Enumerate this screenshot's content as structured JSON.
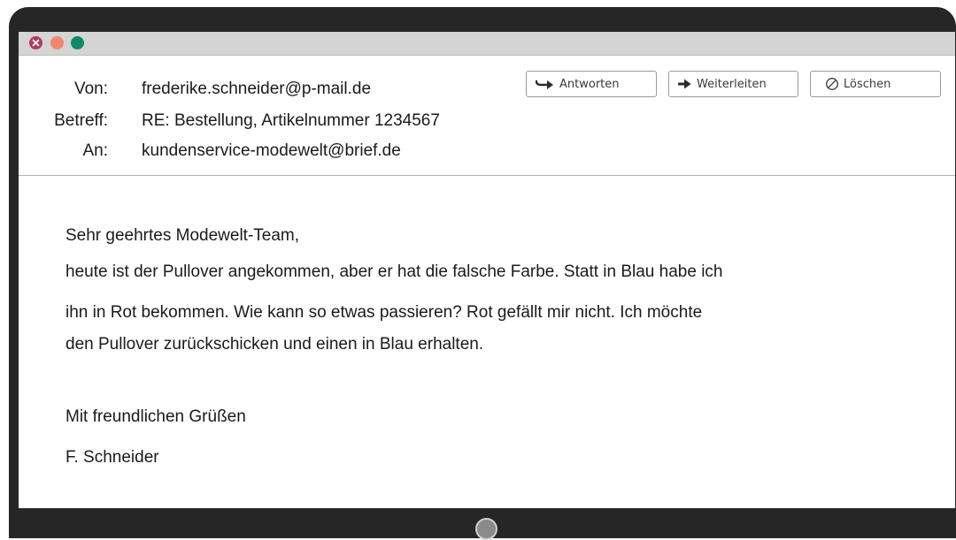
{
  "header": {
    "from_label": "Von:",
    "from_value": "frederike.schneider@p-mail.de",
    "subject_label": "Betreff:",
    "subject_value": "RE: Bestellung, Artikelnummer 1234567",
    "to_label": "An:",
    "to_value": "kundenservice-modewelt@brief.de"
  },
  "toolbar": {
    "reply_label": "Antworten",
    "reply_icon": "reply-arrow-icon",
    "forward_label": "Weiterleiten",
    "forward_icon": "forward-arrow-icon",
    "delete_label": "Löschen",
    "delete_icon": "prohibited-icon"
  },
  "message": {
    "greeting": "Sehr geehrtes Modewelt-Team,",
    "lines": [
      "heute ist der Pullover angekommen, aber er hat die falsche Farbe. Statt in Blau habe ich",
      "ihn in Rot bekommen. Wie kann so etwas passieren? Rot gefällt mir nicht. Ich möchte",
      "den Pullover zurückschicken und einen in Blau erhalten."
    ],
    "closing": "Mit freundlichen Grüßen",
    "signature": "F. Schneider"
  },
  "window_controls": {
    "close_color": "#b23a62",
    "minimize_color": "#f1866d",
    "maximize_color": "#0e8a6a"
  }
}
